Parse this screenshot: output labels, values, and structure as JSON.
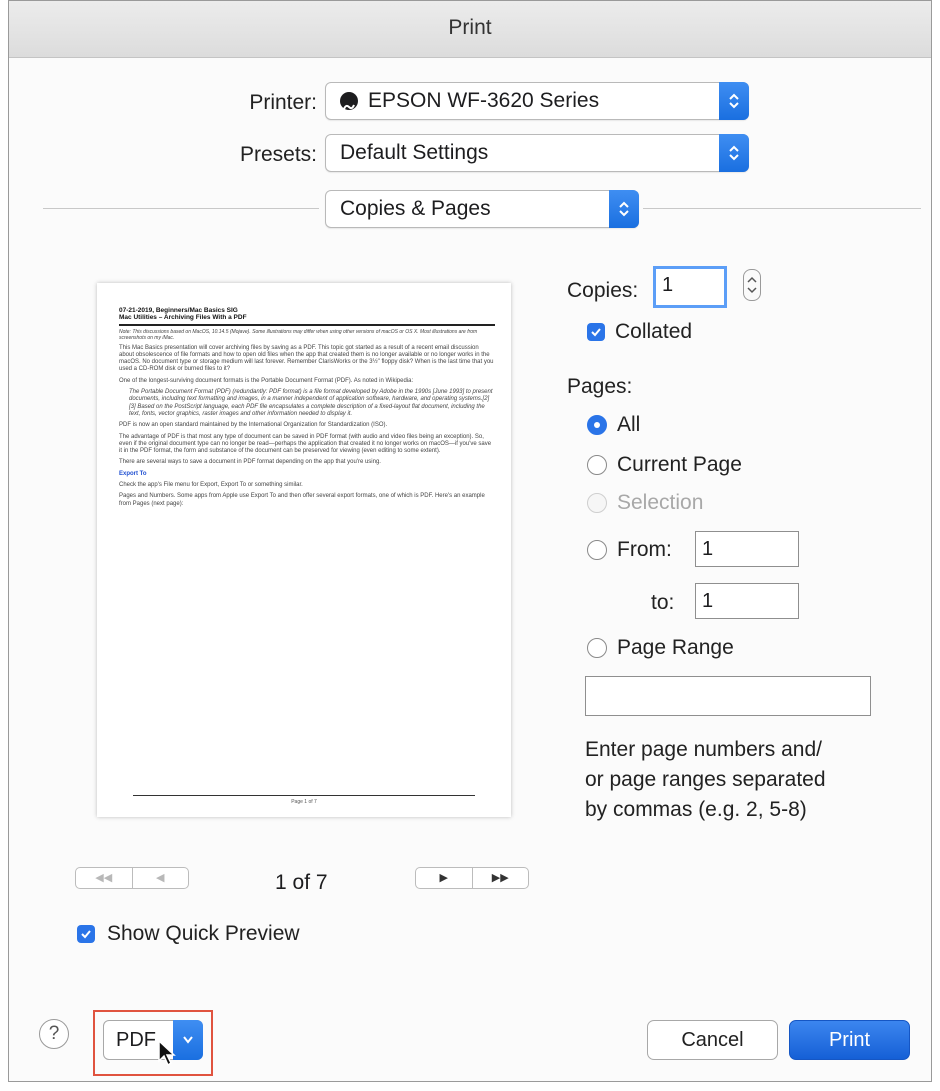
{
  "window": {
    "title": "Print"
  },
  "printer": {
    "label": "Printer:",
    "value": "EPSON WF-3620 Series",
    "icon": "printer-status-icon"
  },
  "presets": {
    "label": "Presets:",
    "value": "Default Settings"
  },
  "section": {
    "value": "Copies & Pages"
  },
  "preview": {
    "heading1": "07-21-2019, Beginners/Mac Basics SIG",
    "heading2": "Mac Utilities – Archiving Files With a PDF",
    "note": "Note: This discussions based on MacOS, 10.14.5 (Mojave). Some illustrations may differ when using other versions of macOS or OS X. Most illustrations are from screenshots on my iMac.",
    "p1": "This Mac Basics presentation will cover archiving files by saving as a PDF. This topic got started as a result of a recent email discussion about obsolescence of file formats and how to open old files when the app that created them is no longer available or no longer works in the macOS. No document type or storage medium will last forever. Remember ClarisWorks or the 3½\" floppy disk? When is the last time that you used a CD-ROM disk or burned files to it?",
    "p2": "One of the longest-surviving document formats is the Portable Document Format (PDF). As noted in Wikipedia:",
    "p3": "The Portable Document Format (PDF) (redundantly: PDF format) is a file format developed by Adobe in the 1990s [June 1993] to present documents, including text formatting and images, in a manner independent of application software, hardware, and operating systems.[2][3] Based on the PostScript language, each PDF file encapsulates a complete description of a fixed-layout flat document, including the text, fonts, vector graphics, raster images and other information needed to display it.",
    "p4": "PDF is now an open standard maintained by the International Organization for Standardization (ISO).",
    "p5": "The advantage of PDF is that most any type of document can be saved in PDF format (with audio and video files being an exception). So, even if the original document type can no longer be read—perhaps the application that created it no longer works on macOS—if you've save it in the PDF format, the form and substance of the document can be preserved for viewing (even editing to some extent).",
    "p6": "There are several ways to save a document in PDF format depending on the app that you're using.",
    "sub": "Export To",
    "p7": "Check the app's File menu for Export, Export To or something similar.",
    "p8": "Pages and Numbers. Some apps from Apple use Export To and then offer several export formats, one of which is PDF. Here's an example from Pages (next page):",
    "footer": "Page 1 of 7"
  },
  "pager": {
    "text": "1 of 7"
  },
  "copies": {
    "label": "Copies:",
    "value": "1",
    "collated_label": "Collated",
    "collated_checked": true
  },
  "pages": {
    "label": "Pages:",
    "all": "All",
    "current": "Current Page",
    "selection": "Selection",
    "from": "From:",
    "from_value": "1",
    "to": "to:",
    "to_value": "1",
    "range": "Page Range",
    "range_value": "",
    "hint1": "Enter page numbers and/",
    "hint2": "or page ranges separated",
    "hint3": "by commas (e.g. 2, 5-8)",
    "selected": "All"
  },
  "quick_preview": {
    "label": "Show Quick Preview",
    "checked": true
  },
  "footer": {
    "help": "?",
    "pdf": "PDF",
    "cancel": "Cancel",
    "print": "Print"
  }
}
